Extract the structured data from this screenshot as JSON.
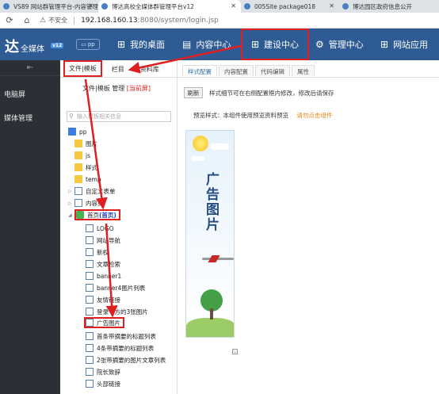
{
  "browser": {
    "tabs": [
      {
        "title": "VS89 网站群管理平台-内容管理"
      },
      {
        "title": "博达高校全媒体群管理平台v12"
      },
      {
        "title": "005Site package018"
      },
      {
        "title": "博达园区政府信息公开"
      }
    ],
    "address": {
      "security_label": "不安全",
      "url_host": "192.168.160.13",
      "url_path": ":8080/system/login.jsp"
    }
  },
  "header": {
    "logo_char": "达",
    "logo_sub": "全媒体",
    "logo_ver": "v12",
    "pp_label": "pp",
    "menu": [
      {
        "label": "我的桌面",
        "icon": "grid-icon"
      },
      {
        "label": "内容中心",
        "icon": "window-icon"
      },
      {
        "label": "建设中心",
        "icon": "grid-icon"
      },
      {
        "label": "管理中心",
        "icon": "gear-icon"
      },
      {
        "label": "网站应用",
        "icon": "apps-icon"
      }
    ]
  },
  "sidebar": {
    "items": [
      {
        "label": "电脑屏"
      },
      {
        "label": "媒体管理"
      }
    ]
  },
  "file_panel": {
    "tabs": [
      {
        "label": "文件|模板"
      },
      {
        "label": "栏目"
      },
      {
        "label": "资料库"
      }
    ],
    "crumb": "文件|模板 管理",
    "crumb_current": "[当前屏]",
    "search_placeholder": "输入模板相关信息",
    "tree": [
      {
        "label": "pp"
      },
      {
        "label": "图片"
      },
      {
        "label": "js"
      },
      {
        "label": "样式"
      },
      {
        "label": "temp"
      },
      {
        "label": "自定义表单"
      },
      {
        "label": "内容页"
      },
      {
        "label": "首页",
        "suffix": "(首页)"
      },
      {
        "label": "LOGO"
      },
      {
        "label": "网站导航"
      },
      {
        "label": "新权"
      },
      {
        "label": "文章检索"
      },
      {
        "label": "banner1"
      },
      {
        "label": "banner4图片列表"
      },
      {
        "label": "友情链接"
      },
      {
        "label": "登录下方的3张图片"
      },
      {
        "label": "广告图片"
      },
      {
        "label": "首条带摘要的标题列表"
      },
      {
        "label": "4条带摘要的标题列表"
      },
      {
        "label": "2张带摘要的图片文章列表"
      },
      {
        "label": "院长致辞"
      },
      {
        "label": "头部链接"
      }
    ]
  },
  "main": {
    "tabs": [
      {
        "label": "样式配置"
      },
      {
        "label": "内容配置"
      },
      {
        "label": "代码编辑"
      },
      {
        "label": "属性"
      }
    ],
    "refresh_label": "刷新",
    "hint": "样式细节可在右侧配置框内修改，修改后请保存",
    "preview_label": "预览样式：本组件使用预览资料预览",
    "preview_link": "请勿点击组件",
    "banner_text": "广告图片"
  },
  "colors": {
    "header_bg": "#2e5b93",
    "sidebar_bg": "#2c2f36",
    "annotation": "#e02020",
    "link": "#e6851e"
  }
}
